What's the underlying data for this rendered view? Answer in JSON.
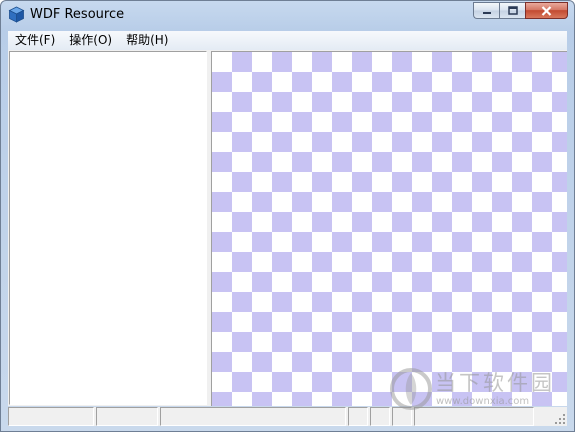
{
  "window": {
    "title": "WDF Resource",
    "icon": "cube-app-icon"
  },
  "menubar": {
    "items": [
      {
        "label": "文件(F)"
      },
      {
        "label": "操作(O)"
      },
      {
        "label": "帮助(H)"
      }
    ]
  },
  "preview": {
    "checker_color": "#c8c3f3",
    "background_color": "#ffffff"
  },
  "statusbar": {
    "cells": [
      "",
      "",
      "",
      "",
      "",
      "",
      ""
    ]
  },
  "watermark": {
    "title": "当下软件园",
    "url": "www.downxia.com"
  }
}
